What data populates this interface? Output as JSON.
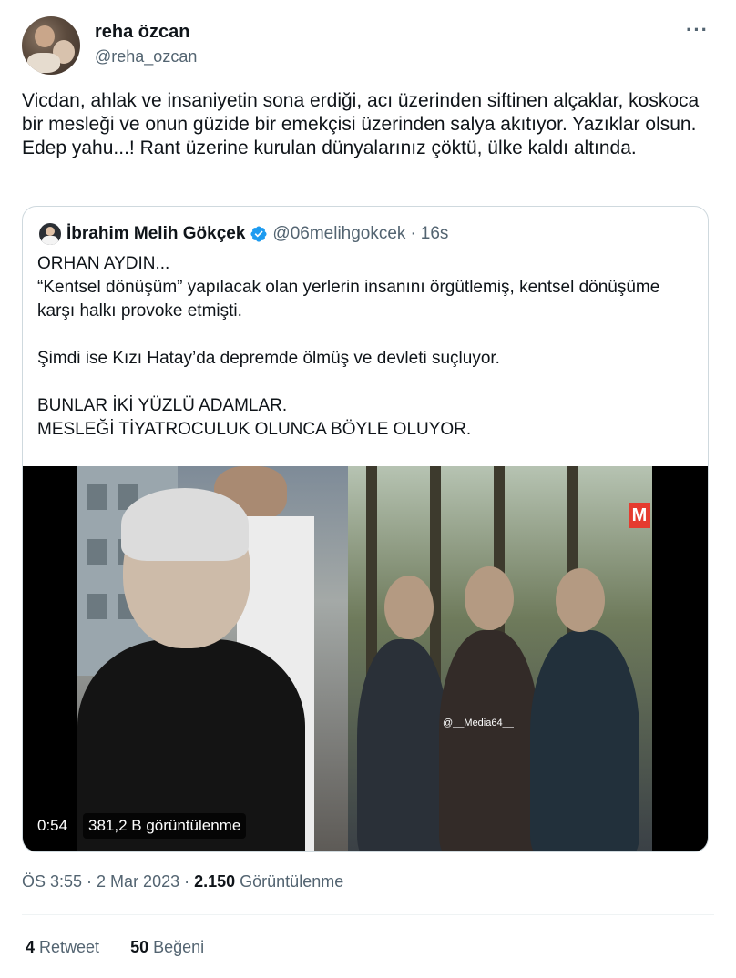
{
  "author": {
    "display_name": "reha özcan",
    "handle": "@reha_ozcan",
    "more_label": "···"
  },
  "tweet": {
    "text": "Vicdan, ahlak ve insaniyetin sona erdiği, acı üzerinden siftinen alçaklar, koskoca bir mesleği ve onun güzide bir emekçisi üzerinden salya akıtıyor. Yazıklar olsun. Edep yahu...! Rant üzerine kurulan dünyalarınız çöktü, ülke kaldı altında."
  },
  "quoted": {
    "display_name": "İbrahim Melih Gökçek",
    "handle": "@06melihgokcek",
    "separator": "·",
    "time": "16s",
    "verified_color": "#1d9bf0",
    "text": "ORHAN AYDIN...\n “Kentsel dönüşüm” yapılacak olan yerlerin insanını örgütlemiş, kentsel dönüşüme karşı halkı provoke etmişti.\n\nŞimdi ise Kızı Hatay’da depremde ölmüş ve devleti suçluyor.\n\nBUNLAR İKİ YÜZLÜ ADAMLAR.\nMESLEĞİ TİYATROCULUK OLUNCA BÖYLE OLUYOR.",
    "video": {
      "duration": "0:54",
      "views": "381,2 B görüntülenme",
      "watermark": "@__Media64__",
      "logo_letter": "M"
    }
  },
  "meta": {
    "time": "ÖS 3:55",
    "sep1": " · ",
    "date": "2 Mar 2023",
    "sep2": " · ",
    "views_count": "2.150",
    "views_label": " Görüntülenme"
  },
  "stats": {
    "retweets_count": "4",
    "retweets_label": " Retweet",
    "likes_count": "50",
    "likes_label": " Beğeni"
  }
}
